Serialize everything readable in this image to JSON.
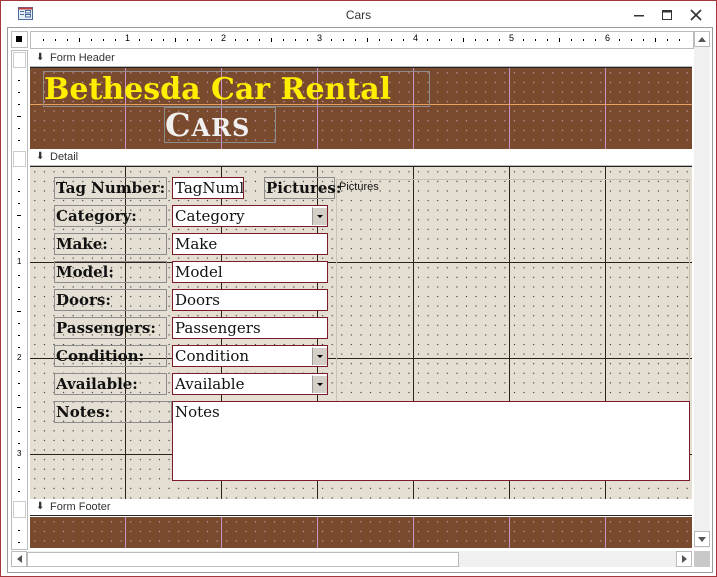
{
  "window": {
    "title": "Cars",
    "buttons": {
      "minimize": "minimize",
      "maximize": "maximize",
      "close": "close"
    }
  },
  "ruler": {
    "horizontal_numbers": [
      "1",
      "2",
      "3",
      "4",
      "5",
      "6"
    ],
    "vertical_numbers": [
      "1",
      "2",
      "3"
    ]
  },
  "sections": {
    "header": "Form Header",
    "detail": "Detail",
    "footer": "Form Footer"
  },
  "header": {
    "title": "Bethesda Car Rental",
    "subtitle_first": "C",
    "subtitle_rest": "ARS"
  },
  "detail": {
    "fields": [
      {
        "label": "Tag Number:",
        "control": "TagNuml",
        "type": "textbox"
      },
      {
        "label": "Category:",
        "control": "Category",
        "type": "combobox"
      },
      {
        "label": "Make:",
        "control": "Make",
        "type": "textbox"
      },
      {
        "label": "Model:",
        "control": "Model",
        "type": "textbox"
      },
      {
        "label": "Doors:",
        "control": "Doors",
        "type": "textbox"
      },
      {
        "label": "Passengers:",
        "control": "Passengers",
        "type": "textbox"
      },
      {
        "label": "Condition:",
        "control": "Condition",
        "type": "combobox"
      },
      {
        "label": "Available:",
        "control": "Available",
        "type": "combobox"
      },
      {
        "label": "Notes:",
        "control": "Notes",
        "type": "memo"
      }
    ],
    "pictures_label": "Pictures:",
    "pictures_control": "Pictures"
  },
  "colors": {
    "header_bg": "#7a4a2e",
    "title_color": "#ffee00",
    "detail_bg": "#e5dfd3",
    "control_border": "#7a1a2a",
    "window_border": "#a4373a"
  }
}
